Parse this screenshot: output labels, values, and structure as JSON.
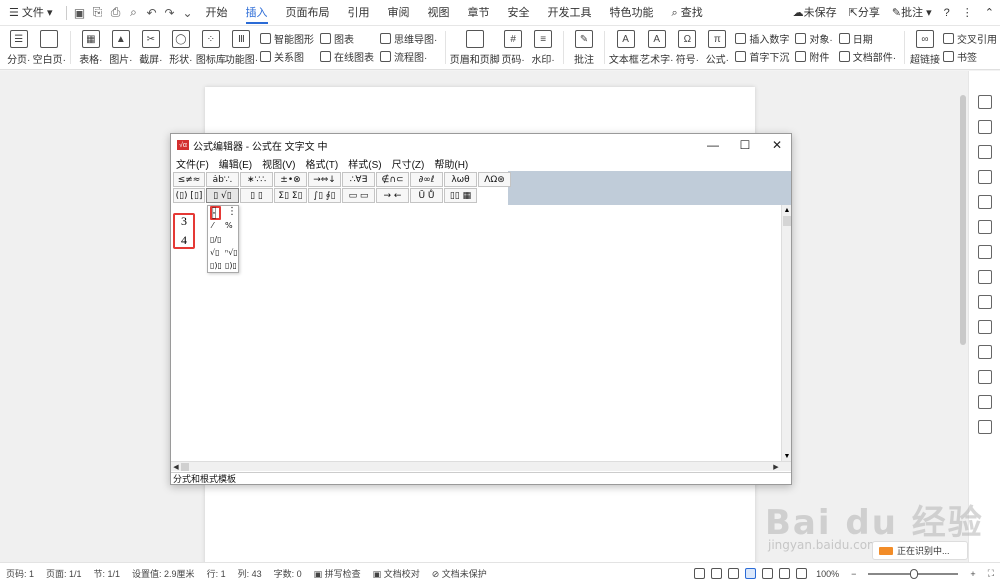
{
  "menubar": {
    "file": "文件",
    "tabs": [
      "开始",
      "插入",
      "页面布局",
      "引用",
      "审阅",
      "视图",
      "章节",
      "安全",
      "开发工具",
      "特色功能"
    ],
    "active_tab": "插入",
    "search": "查找",
    "unsaved": "未保存",
    "share": "分享",
    "comment": "批注",
    "help": "?"
  },
  "ribbon": {
    "large": [
      {
        "label": "分页·",
        "icon": "page-break-icon"
      },
      {
        "label": "空白页·",
        "icon": "blank-page-icon"
      },
      {
        "label": "表格·",
        "icon": "table-icon"
      },
      {
        "label": "图片·",
        "icon": "picture-icon"
      },
      {
        "label": "截屏·",
        "icon": "screenshot-icon"
      },
      {
        "label": "形状·",
        "icon": "shape-icon"
      },
      {
        "label": "图标库",
        "icon": "icon-library-icon"
      },
      {
        "label": "功能图·",
        "icon": "function-chart-icon"
      }
    ],
    "small_a": [
      "智能图形",
      "关系图"
    ],
    "small_b": [
      "图表",
      "在线图表"
    ],
    "small_c": [
      "思维导图·",
      "流程图·"
    ],
    "large2": [
      {
        "label": "页眉和页脚",
        "icon": "header-footer-icon"
      },
      {
        "label": "页码·",
        "icon": "page-number-icon"
      },
      {
        "label": "水印·",
        "icon": "watermark-icon"
      },
      {
        "label": "批注",
        "icon": "comment-icon"
      },
      {
        "label": "文本框·",
        "icon": "textbox-icon"
      },
      {
        "label": "艺术字·",
        "icon": "wordart-icon"
      },
      {
        "label": "符号·",
        "icon": "symbol-icon"
      },
      {
        "label": "公式·",
        "icon": "formula-icon"
      }
    ],
    "small_d": [
      "插入数字",
      "首字下沉"
    ],
    "small_e": [
      "对象·",
      "附件"
    ],
    "small_f": [
      "日期",
      "文档部件·"
    ],
    "large3": [
      {
        "label": "超链接",
        "icon": "hyperlink-icon"
      }
    ],
    "small_g": [
      "交叉引用",
      "书签"
    ]
  },
  "editor": {
    "title": "公式编辑器 - 公式在 文字文 中",
    "menus": [
      "文件(F)",
      "编辑(E)",
      "视图(V)",
      "格式(T)",
      "样式(S)",
      "尺寸(Z)",
      "帮助(H)"
    ],
    "palette_row1": [
      "≤≠≈",
      "ȧb∵.",
      "∗∵∴",
      "±•⊗",
      "→⇔↓",
      "∴∀∃",
      "∉∩⊂",
      "∂∞ℓ",
      "λωθ",
      "ΛΩ⊛"
    ],
    "palette_row2": [
      "(▯) [▯]",
      "▯ √▯",
      "▯ ▯",
      "Σ▯ Σ▯",
      "∫▯ ∮▯",
      "▭ ▭",
      "→ ←",
      "Ū Ů",
      "▯▯ ▦"
    ],
    "fraction": {
      "numerator": "3",
      "denominator": "4"
    },
    "template_items": [
      "⁄",
      "⁰⁄₀",
      "▯/▯",
      "√▯",
      "ⁿ√▯"
    ],
    "status": "分式和根式模板"
  },
  "statusbar": {
    "page": "页码: 1",
    "pages": "页面: 1/1",
    "section": "节: 1/1",
    "setting": "设置值: 2.9厘米",
    "row": "行: 1",
    "col": "列: 43",
    "words": "字数: 0",
    "spell": "拼写检查",
    "proof": "文档校对",
    "protect": "文档未保护",
    "zoom": "100%"
  },
  "watermark": {
    "text": "Bai du 经验",
    "sub": "jingyan.baidu.com"
  },
  "toast": "正在识别中..."
}
